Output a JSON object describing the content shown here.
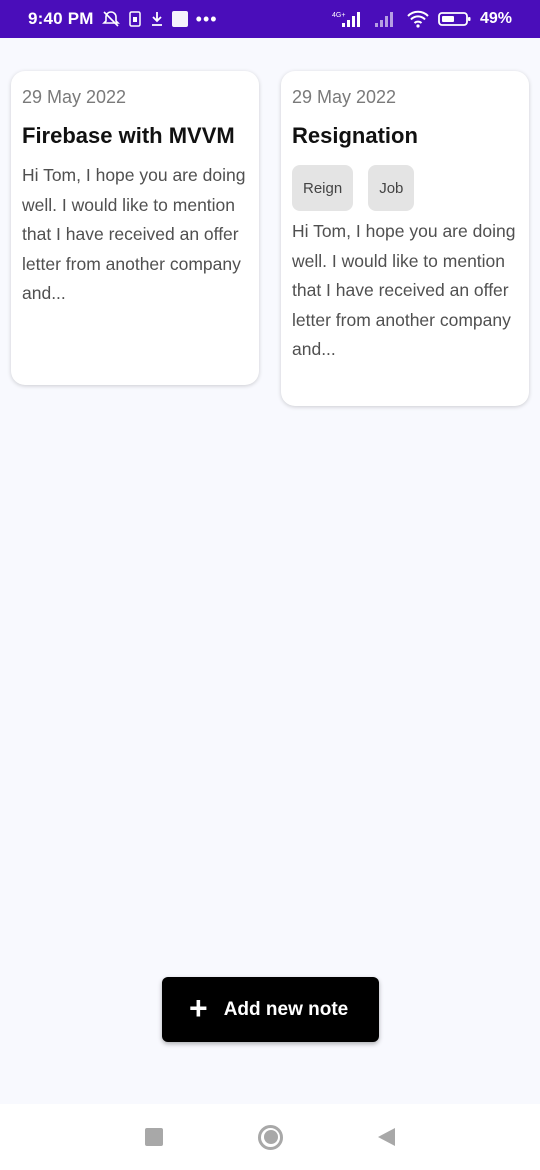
{
  "status_bar": {
    "time": "9:40 PM",
    "left_icons": [
      "bell-off-icon",
      "sim-icon",
      "download-icon",
      "app-icon",
      "more-icon"
    ],
    "more_label": "•••",
    "network_label": "4G+",
    "battery_percent": "49%"
  },
  "notes": [
    {
      "date": "29 May 2022",
      "title": "Firebase with MVVM",
      "tags": [],
      "body": "Hi Tom, I hope you are doing well. I would like to mention that I have received an offer letter from another company and..."
    },
    {
      "date": "29 May 2022",
      "title": "Resignation",
      "tags": [
        "Reign",
        "Job"
      ],
      "body": "Hi Tom, I hope you are doing well. I would like to mention that I have received an offer letter from another company and..."
    }
  ],
  "fab": {
    "icon": "plus-icon",
    "plus_glyph": "+",
    "label": "Add new note"
  },
  "nav_bar": {
    "items": [
      "recents-button",
      "home-button",
      "back-button"
    ]
  },
  "colors": {
    "status_bar": "#4a0dba",
    "background": "#f8f9fe",
    "fab": "#000000",
    "tag_bg": "#e4e4e4"
  }
}
